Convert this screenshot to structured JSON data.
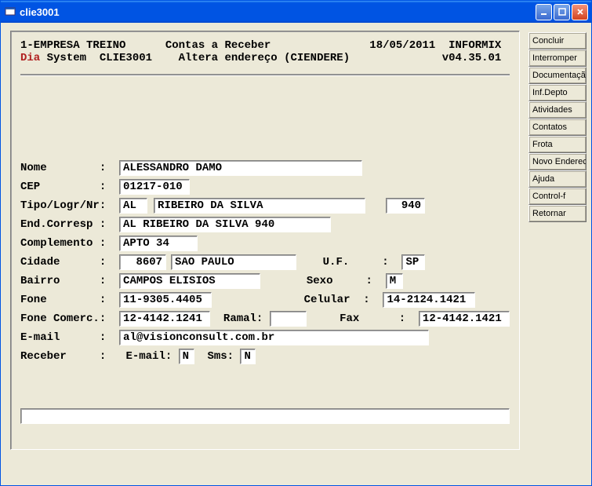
{
  "window": {
    "title": "clie3001"
  },
  "header": {
    "line1": {
      "company": "1-EMPRESA TREINO",
      "module": "Contas a Receber",
      "date": "18/05/2011",
      "db": "INFORMIX"
    },
    "line2": {
      "accent": "Dia",
      "rest": " System  CLIE3001",
      "subtitle": "Altera endereço (CIENDERE)",
      "version": "v04.35.01"
    }
  },
  "form": {
    "nome": {
      "label": "Nome",
      "value": "ALESSANDRO DAMO"
    },
    "cep": {
      "label": "CEP",
      "value": "01217-010"
    },
    "tipo": {
      "label": "Tipo/Logr/Nr",
      "tipo": "AL",
      "logr": "RIBEIRO DA SILVA",
      "nr": "940"
    },
    "endc": {
      "label": "End.Corresp",
      "value": "AL RIBEIRO DA SILVA 940"
    },
    "compl": {
      "label": "Complemento",
      "value": "APTO 34"
    },
    "cidade": {
      "label": "Cidade",
      "codigo": "8607",
      "nome": "SAO PAULO"
    },
    "uf": {
      "label": "U.F.",
      "value": "SP"
    },
    "bairro": {
      "label": "Bairro",
      "value": "CAMPOS ELISIOS"
    },
    "sexo": {
      "label": "Sexo",
      "value": "M"
    },
    "fone": {
      "label": "Fone",
      "value": "11-9305.4405"
    },
    "celular": {
      "label": "Celular",
      "value": "14-2124.1421"
    },
    "fonec": {
      "label": "Fone Comerc.",
      "value": "12-4142.1241"
    },
    "ramal": {
      "label": "Ramal:",
      "value": ""
    },
    "fax": {
      "label": "Fax",
      "value": "12-4142.1421"
    },
    "email": {
      "label": "E-mail",
      "value": "al@visionconsult.com.br"
    },
    "receber": {
      "label": "Receber",
      "email_label": "E-mail:",
      "email_value": "N",
      "sms_label": "Sms:",
      "sms_value": "N"
    }
  },
  "buttons": [
    "Concluir",
    "Interromper",
    "Documentação",
    "Inf.Depto",
    "Atividades",
    "Contatos",
    "Frota",
    "Novo Endereco",
    "Ajuda",
    "Control-f",
    "Retornar"
  ]
}
